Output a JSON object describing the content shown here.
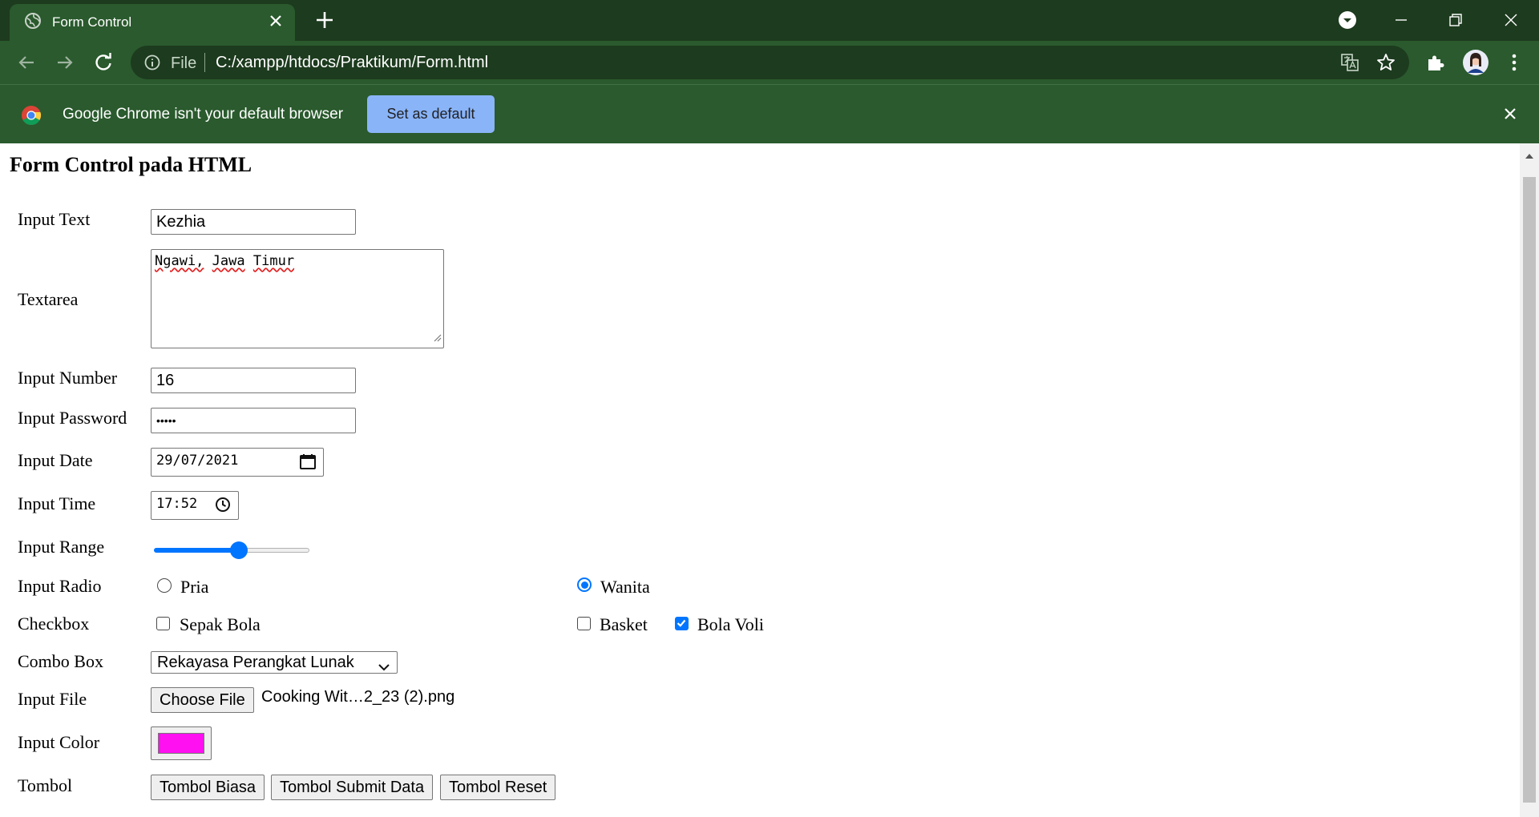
{
  "browser": {
    "tab_title": "Form Control",
    "omnibox": {
      "scheme": "File",
      "url": "C:/xampp/htdocs/Praktikum/Form.html"
    },
    "infobar": {
      "message": "Google Chrome isn't your default browser",
      "button": "Set as default"
    }
  },
  "page": {
    "title": "Form Control pada HTML",
    "input_text": {
      "label": "Input Text",
      "value": "Kezhia"
    },
    "textarea": {
      "label": "Textarea",
      "words": [
        "Ngawi,",
        "Jawa",
        "Timur"
      ]
    },
    "input_number": {
      "label": "Input Number",
      "value": "16"
    },
    "input_password": {
      "label": "Input Password",
      "value": "•••••"
    },
    "input_date": {
      "label": "Input Date",
      "value": "29/07/2021"
    },
    "input_time": {
      "label": "Input Time",
      "value": "17:52"
    },
    "input_range": {
      "label": "Input Range",
      "value_fraction": 0.55
    },
    "input_radio": {
      "label": "Input Radio",
      "options": [
        {
          "label": "Pria",
          "checked": false
        },
        {
          "label": "Wanita",
          "checked": true
        }
      ]
    },
    "checkbox": {
      "label": "Checkbox",
      "options": [
        {
          "label": "Sepak Bola",
          "checked": false
        },
        {
          "label": "Basket",
          "checked": false
        },
        {
          "label": "Bola Voli",
          "checked": true
        }
      ]
    },
    "combo_box": {
      "label": "Combo Box",
      "selected": "Rekayasa Perangkat Lunak"
    },
    "input_file": {
      "label": "Input File",
      "button": "Choose File",
      "filename": "Cooking Wit…2_23 (2).png"
    },
    "input_color": {
      "label": "Input Color",
      "color": "#ff10f0"
    },
    "tombol": {
      "label": "Tombol",
      "buttons": [
        "Tombol Biasa",
        "Tombol Submit Data",
        "Tombol Reset"
      ]
    }
  },
  "colors": {
    "chrome_dark": "#1d3b1e",
    "chrome": "#2a5a2d",
    "accent": "#0075ff",
    "infobar_button": "#8ab4f8"
  },
  "icons": [
    "globe-icon",
    "close-icon",
    "plus-icon",
    "tab-search-icon",
    "minimize-icon",
    "restore-icon",
    "back-icon",
    "forward-icon",
    "reload-icon",
    "info-icon",
    "translate-icon",
    "star-icon",
    "extensions-icon",
    "avatar",
    "kebab-menu-icon",
    "chrome-logo-icon",
    "calendar-icon",
    "clock-icon",
    "chevron-down-icon"
  ]
}
